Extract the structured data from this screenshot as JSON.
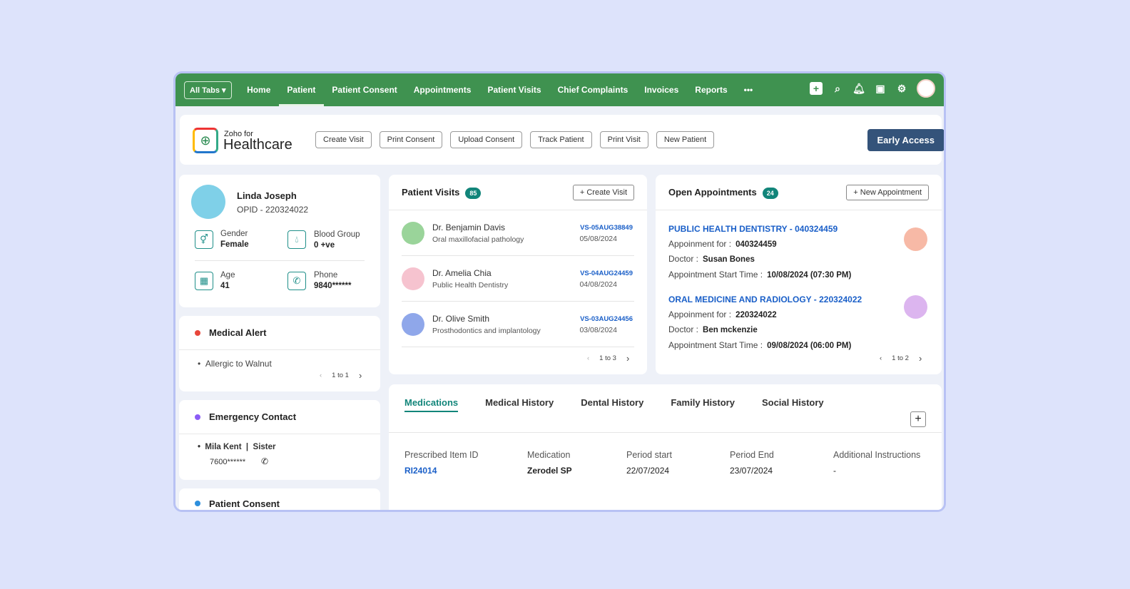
{
  "nav": {
    "all_tabs": "All Tabs",
    "items": [
      "Home",
      "Patient",
      "Patient Consent",
      "Appointments",
      "Patient Visits",
      "Chief Complaints",
      "Invoices",
      "Reports"
    ],
    "more": "•••",
    "active": "Patient"
  },
  "header": {
    "brand_small": "Zoho for",
    "brand_large": "Healthcare",
    "buttons": [
      "Create Visit",
      "Print Consent",
      "Upload Consent",
      "Track Patient",
      "Print Visit",
      "New Patient"
    ],
    "early_access": "Early Access"
  },
  "patient": {
    "name": "Linda Joseph",
    "opid": "OPID - 220324022",
    "gender_label": "Gender",
    "gender": "Female",
    "blood_label": "Blood Group",
    "blood": "0 +ve",
    "age_label": "Age",
    "age": "41",
    "phone_label": "Phone",
    "phone": "9840******"
  },
  "medical_alert": {
    "title": "Medical Alert",
    "item": "Allergic to Walnut",
    "pager": "1 to 1"
  },
  "emergency": {
    "title": "Emergency Contact",
    "name": "Mila Kent",
    "relation": "Sister",
    "phone": "7600******"
  },
  "consent": {
    "title": "Patient Consent"
  },
  "visits": {
    "title": "Patient Visits",
    "count": "85",
    "create": "Create Visit",
    "pager": "1 to 3",
    "items": [
      {
        "doctor": "Dr. Benjamin Davis",
        "specialty": "Oral maxillofacial pathology",
        "id": "VS-05AUG38849",
        "date": "05/08/2024"
      },
      {
        "doctor": "Dr. Amelia Chia",
        "specialty": "Public Health Dentistry",
        "id": "VS-04AUG24459",
        "date": "04/08/2024"
      },
      {
        "doctor": "Dr. Olive Smith",
        "specialty": "Prosthodontics and implantology",
        "id": "VS-03AUG24456",
        "date": "03/08/2024"
      }
    ]
  },
  "appointments": {
    "title": "Open Appointments",
    "count": "24",
    "new": "New Appointment",
    "pager": "1 to 2",
    "for_label": "Appoinment for :",
    "doctor_label": "Doctor :",
    "time_label": "Appointment Start Time :",
    "items": [
      {
        "title": "PUBLIC HEALTH DENTISTRY - 040324459",
        "for": "040324459",
        "doctor": "Susan Bones",
        "time": "10/08/2024 (07:30 PM)"
      },
      {
        "title": "ORAL MEDICINE AND RADIOLOGY - 220324022",
        "for": "220324022",
        "doctor": "Ben mckenzie",
        "time": "09/08/2024 (06:00 PM)"
      }
    ]
  },
  "history": {
    "tabs": [
      "Medications",
      "Medical History",
      "Dental History",
      "Family History",
      "Social History"
    ],
    "columns": [
      "Prescribed Item ID",
      "Medication",
      "Period start",
      "Period End",
      "Additional Instructions"
    ],
    "row": [
      "RI24014",
      "Zerodel SP",
      "22/07/2024",
      "23/07/2024",
      "-"
    ]
  }
}
